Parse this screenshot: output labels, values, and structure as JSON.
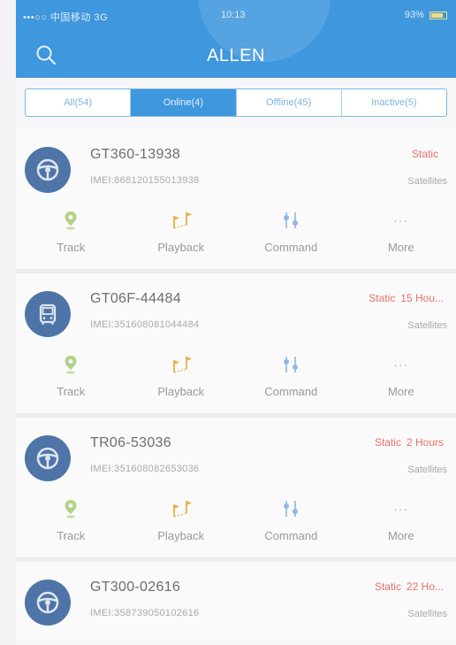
{
  "status_bar": {
    "carrier": "•••○○ 中国移动 3G",
    "time": "10:13",
    "battery": "93%"
  },
  "header": {
    "title": "ALLEN"
  },
  "tabs": [
    {
      "label": "All(54)",
      "active": false
    },
    {
      "label": "Online(4)",
      "active": true
    },
    {
      "label": "Offline(45)",
      "active": false
    },
    {
      "label": "Inactive(5)",
      "active": false
    }
  ],
  "actions": {
    "track": "Track",
    "playback": "Playback",
    "command": "Command",
    "more": "More",
    "more_dots": "···"
  },
  "devices": [
    {
      "name": "GT360-13938",
      "imei": "IMEI:868120155013938",
      "status": "Static",
      "duration": "",
      "signal": "Satellites",
      "icon": "steering-wheel-icon"
    },
    {
      "name": "GT06F-44484",
      "imei": "IMEI:351608081044484",
      "status": "Static",
      "duration": "15 Hou...",
      "signal": "Satellites",
      "icon": "bus-icon"
    },
    {
      "name": "TR06-53036",
      "imei": "IMEI:351608082653036",
      "status": "Static",
      "duration": "2 Hours",
      "signal": "Satellites",
      "icon": "steering-wheel-icon"
    },
    {
      "name": "GT300-02616",
      "imei": "IMEI:358739050102616",
      "status": "Static",
      "duration": "22 Ho...",
      "signal": "Satellites",
      "icon": "steering-wheel-icon"
    }
  ],
  "colors": {
    "header": "#3f97dd",
    "avatar": "#4f74a8",
    "status": "#e8706a"
  }
}
